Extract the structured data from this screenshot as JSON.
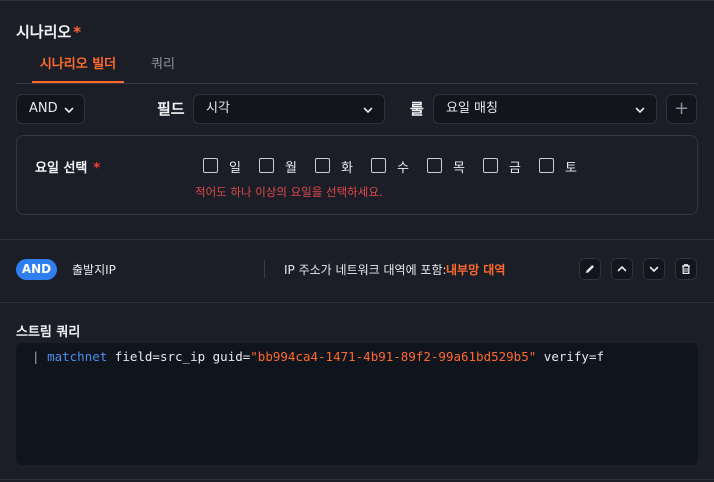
{
  "section": {
    "title": "시나리오",
    "required_mark": "*"
  },
  "tabs": [
    {
      "label": "시나리오 빌더",
      "active": true
    },
    {
      "label": "쿼리",
      "active": false
    }
  ],
  "controls": {
    "logic_select": "AND",
    "field_label": "필드",
    "field_value": "시각",
    "rule_label": "룰",
    "rule_value": "요일 매칭",
    "add_symbol": "+"
  },
  "day_select": {
    "label": "요일 선택",
    "required_mark": "*",
    "days": [
      "일",
      "월",
      "화",
      "수",
      "목",
      "금",
      "토"
    ],
    "error": "적어도 하나 이상의 요일을 선택하세요."
  },
  "condition": {
    "logic": "AND",
    "field": "출발지IP",
    "operator": "IP 주소가 네트워크 대역에 포함:",
    "value": "내부망 대역"
  },
  "stream": {
    "title": "스트림 쿼리",
    "pipe": "|",
    "command": "matchnet",
    "args_before": " field=src_ip guid=",
    "guid": "\"bb994ca4-1471-4b91-89f2-99a61bd529b5\"",
    "args_after": " verify=f"
  },
  "colors": {
    "accent": "#ff6a2b",
    "pill": "#2f7ff0",
    "error": "#e0474c"
  }
}
